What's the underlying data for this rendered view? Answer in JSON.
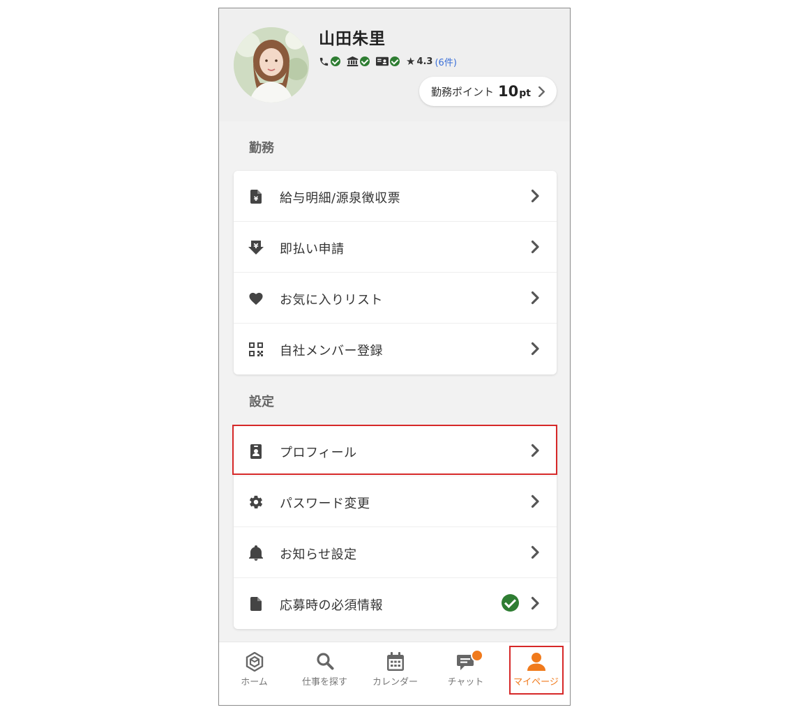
{
  "profile": {
    "name": "山田朱里",
    "rating": "4.3",
    "rating_count": "(6件)",
    "points_label": "勤務ポイント",
    "points_value": "10",
    "points_unit": "pt",
    "verified_icons": [
      "phone-icon",
      "bank-icon",
      "id-card-icon"
    ]
  },
  "sections": [
    {
      "title": "勤務",
      "items": [
        {
          "label": "給与明細/源泉徴収票",
          "icon": "yen-document-icon"
        },
        {
          "label": "即払い申請",
          "icon": "yen-download-icon"
        },
        {
          "label": "お気に入りリスト",
          "icon": "heart-icon"
        },
        {
          "label": "自社メンバー登録",
          "icon": "qr-code-icon"
        }
      ]
    },
    {
      "title": "設定",
      "items": [
        {
          "label": "プロフィール",
          "icon": "id-badge-icon"
        },
        {
          "label": "パスワード変更",
          "icon": "gear-icon"
        },
        {
          "label": "お知らせ設定",
          "icon": "bell-icon"
        },
        {
          "label": "応募時の必須情報",
          "icon": "file-icon",
          "status": "completed"
        }
      ]
    }
  ],
  "tabbar": {
    "tabs": [
      {
        "label": "ホーム",
        "icon": "home-cube-icon"
      },
      {
        "label": "仕事を探す",
        "icon": "search-icon"
      },
      {
        "label": "カレンダー",
        "icon": "calendar-icon"
      },
      {
        "label": "チャット",
        "icon": "chat-icon",
        "has_notification": true
      },
      {
        "label": "マイページ",
        "icon": "user-icon",
        "active": true
      }
    ]
  },
  "colors": {
    "accent": "#f07a1c",
    "verified": "#2e7d32",
    "link": "#3a6fd8",
    "highlight": "#d62828"
  }
}
